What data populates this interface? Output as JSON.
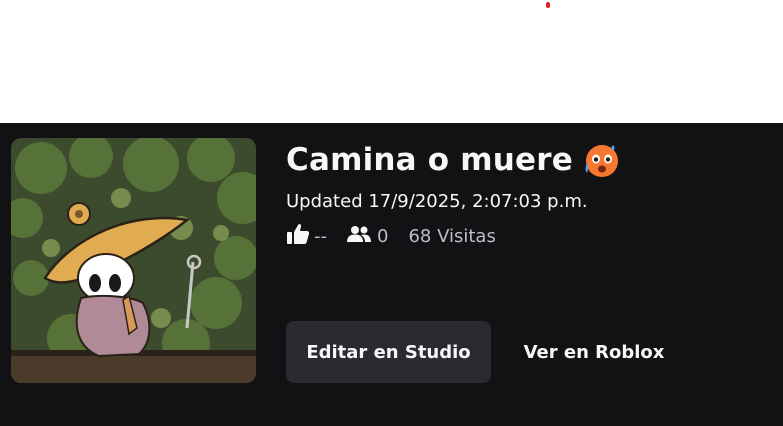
{
  "experience": {
    "title": "Camina o muere",
    "title_emoji": "hot-face-emoji",
    "updated": "Updated 17/9/2025, 2:07:03 p.m.",
    "thumbnail": "thumbnail-image",
    "stats": {
      "likes_icon": "thumbs-up-icon",
      "likes": "--",
      "players_icon": "people-icon",
      "players": "0",
      "visits": "68 Visitas"
    }
  },
  "actions": {
    "edit_studio": "Editar en Studio",
    "view_roblox": "Ver en Roblox"
  },
  "colors": {
    "panel_bg": "#121215",
    "primary_button_bg": "#2a2b30",
    "text": "#f7f7f8",
    "muted_text": "#bcbec8"
  }
}
